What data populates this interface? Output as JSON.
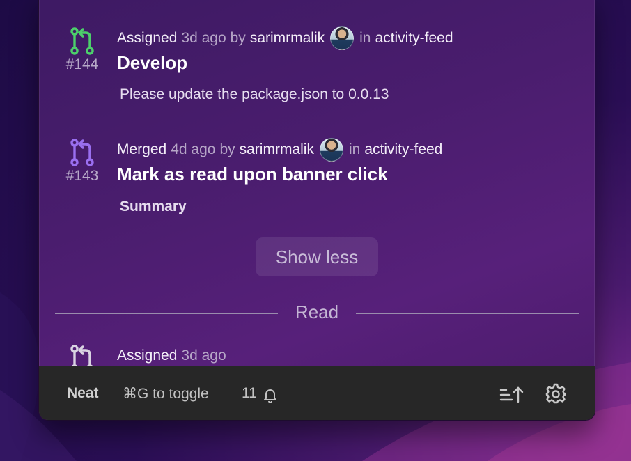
{
  "feed": {
    "items": [
      {
        "action": "Assigned",
        "time": "3d ago",
        "by": "by",
        "user": "sarimrmalik",
        "in": "in",
        "repo": "activity-feed",
        "number": "#144",
        "title": "Develop",
        "body": "Please update the package.json to 0.0.13",
        "icon": "pull-request-icon",
        "icon_color": "#4ccf6b"
      },
      {
        "action": "Merged",
        "time": "4d ago",
        "by": "by",
        "user": "sarimrmalik",
        "in": "in",
        "repo": "activity-feed",
        "number": "#143",
        "title": "Mark as read upon banner click",
        "body": "Summary",
        "icon": "pull-request-icon",
        "icon_color": "#9a6ff0"
      },
      {
        "action": "Assigned",
        "time": "3d ago",
        "icon": "pull-request-icon",
        "icon_color": "#d9d3e2"
      }
    ],
    "show_less_label": "Show less",
    "read_divider_label": "Read"
  },
  "footer": {
    "brand": "Neat",
    "toggle_hint": "⌘G to toggle",
    "notification_count": "11"
  }
}
